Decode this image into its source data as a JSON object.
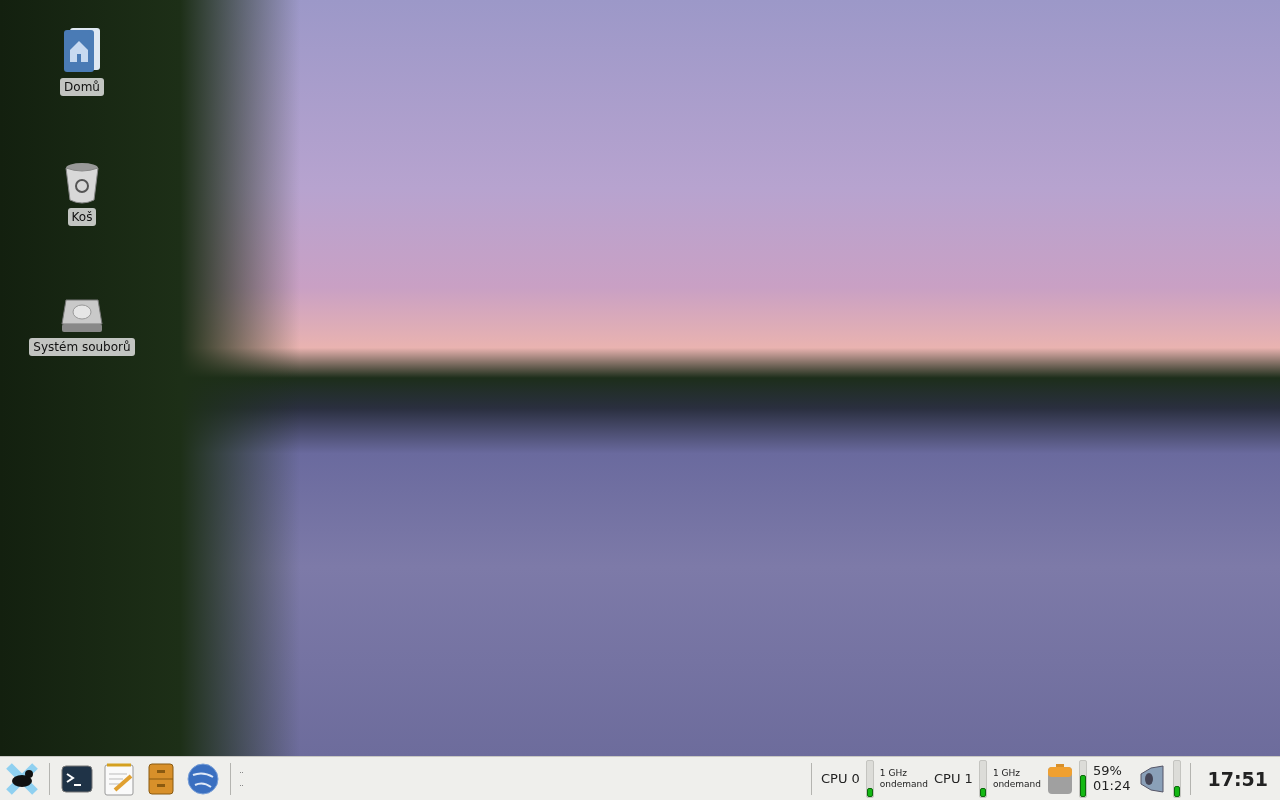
{
  "desktop": {
    "icons": [
      {
        "label": "Domů",
        "kind": "home"
      },
      {
        "label": "Koš",
        "kind": "trash"
      },
      {
        "label": "Systém souborů",
        "kind": "drive"
      }
    ]
  },
  "panel": {
    "launchers": [
      {
        "kind": "menu"
      },
      {
        "kind": "terminal"
      },
      {
        "kind": "editor"
      },
      {
        "kind": "files"
      },
      {
        "kind": "browser"
      }
    ],
    "cpus": [
      {
        "label": "CPU 0",
        "level": 0.25,
        "frequency": "1 GHz",
        "governor": "ondemand"
      },
      {
        "label": "CPU 1",
        "level": 0.25,
        "frequency": "1 GHz",
        "governor": "ondemand"
      }
    ],
    "battery": {
      "level": 0.6,
      "percent": "59%",
      "time": "01:24"
    },
    "volume": {
      "level": 0.3
    },
    "clock": "17:51"
  }
}
